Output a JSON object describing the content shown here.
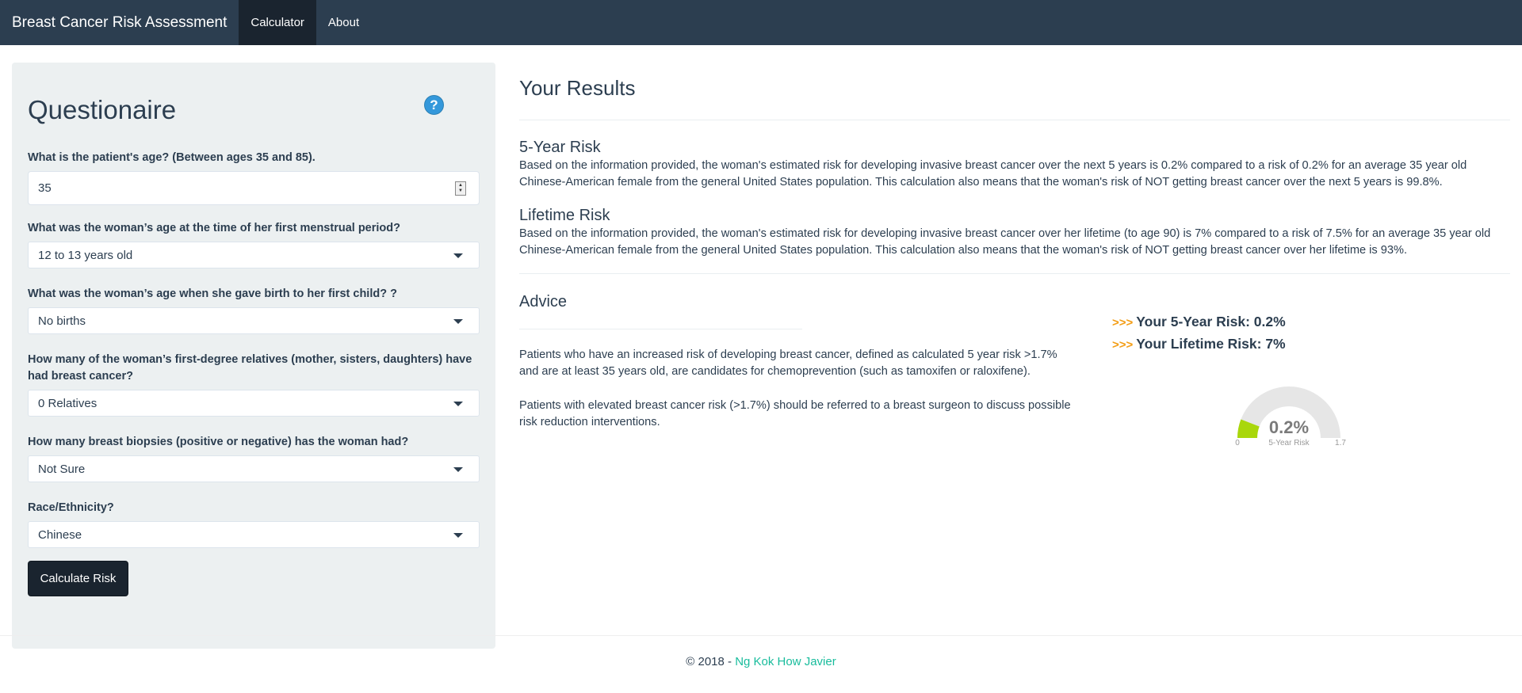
{
  "nav": {
    "brand": "Breast Cancer Risk Assessment",
    "items": [
      {
        "label": "Calculator",
        "active": true
      },
      {
        "label": "About",
        "active": false
      }
    ]
  },
  "questionnaire": {
    "title": "Questionaire",
    "help_icon": "?",
    "age": {
      "label": "What is the patient's age? (Between ages 35 and 85).",
      "value": "35"
    },
    "menarche": {
      "label": "What was the woman’s age at the time of her first menstrual period?",
      "value": "12 to 13 years old"
    },
    "first_birth": {
      "label": "What was the woman’s age when she gave birth to her first child? ?",
      "value": "No births"
    },
    "relatives": {
      "label": "How many of the woman’s first-degree relatives (mother, sisters, daughters) have had breast cancer?",
      "value": "0 Relatives"
    },
    "biopsies": {
      "label": "How many breast biopsies (positive or negative) has the woman had?",
      "value": "Not Sure"
    },
    "race": {
      "label": "Race/Ethnicity?",
      "value": "Chinese"
    },
    "calculate_label": "Calculate Risk"
  },
  "results": {
    "title": "Your Results",
    "five_year": {
      "title": "5-Year Risk",
      "text": "Based on the information provided, the woman's estimated risk for developing invasive breast cancer over the next 5 years is 0.2% compared to a risk of 0.2% for an average 35 year old Chinese-American female from the general United States population. This calculation also means that the woman's risk of NOT getting breast cancer over the next 5 years is 99.8%."
    },
    "lifetime": {
      "title": "Lifetime Risk",
      "text": "Based on the information provided, the woman's estimated risk for developing invasive breast cancer over her lifetime (to age 90) is 7% compared to a risk of 7.5% for an average 35 year old Chinese-American female from the general United States population. This calculation also means that the woman's risk of NOT getting breast cancer over her lifetime is 93%."
    },
    "advice": {
      "title": "Advice",
      "p1": "Patients who have an increased risk of developing breast cancer, defined as calculated 5 year risk >1.7% and are at least 35 years old, are candidates for chemoprevention (such as tamoxifen or raloxifene).",
      "p2": "Patients with elevated breast cancer risk (>1.7%) should be referred to a breast surgeon to discuss possible risk reduction interventions."
    },
    "summary": {
      "arrows": ">>>",
      "five_year": "Your 5-Year Risk: 0.2%",
      "lifetime": "Your Lifetime Risk: 7%"
    },
    "gauge": {
      "value": 0.2,
      "min": 0,
      "max": 1.7,
      "value_label": "0.2%",
      "caption": "5-Year Risk",
      "min_label": "0",
      "max_label": "1.7",
      "fill_color": "#a9d70b",
      "track_color": "#e6e6e6"
    }
  },
  "footer": {
    "prefix": "© 2018 - ",
    "author": "Ng Kok How Javier"
  },
  "colors": {
    "navbar": "#2c3e50",
    "accent_link": "#18bc9c",
    "arrow_orange": "#f39c12",
    "help_blue": "#3498db"
  }
}
